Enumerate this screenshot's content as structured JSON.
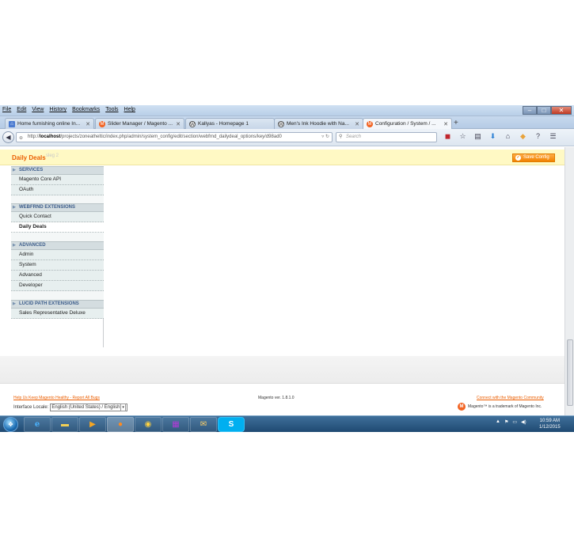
{
  "menu": [
    "File",
    "Edit",
    "View",
    "History",
    "Bookmarks",
    "Tools",
    "Help"
  ],
  "window_buttons": {
    "minimize": "–",
    "maximize": "□",
    "close": "✕"
  },
  "tabs": [
    {
      "label": "Home furnishing online In...",
      "icon": "home-icon"
    },
    {
      "label": "Slider Manager / Magento ...",
      "icon": "magento-icon"
    },
    {
      "label": "Kallyas - Homepage 1",
      "icon": "wordpress-icon"
    },
    {
      "label": "Men's Ink Hoodie with Na...",
      "icon": "wordpress-icon"
    },
    {
      "label": "Configuration / System / ...",
      "icon": "magento-icon",
      "active": true
    }
  ],
  "url": {
    "prefix": "http://",
    "host": "localhost",
    "path": "/projects/zoneatheltic/index.php/admin/system_config/edit/section/webfrnd_dailydeal_options/key/d98ad0"
  },
  "search": {
    "placeholder": "Search"
  },
  "page": {
    "title": "Daily Deals",
    "ghost_text": "sleg 2",
    "save_button": "Save Config"
  },
  "sidebar": {
    "sections": [
      {
        "header": "SERVICES",
        "items": [
          "Magento Core API",
          "OAuth"
        ]
      },
      {
        "header": "WEBFRND EXTENSIONS",
        "items": [
          "Quick Contact",
          "Daily Deals"
        ]
      },
      {
        "header": "ADVANCED",
        "items": [
          "Admin",
          "System",
          "Advanced",
          "Developer"
        ]
      },
      {
        "header": "LUCID PATH EXTENSIONS",
        "items": [
          "Sales Representative Deluxe"
        ]
      }
    ],
    "active_item": "Daily Deals"
  },
  "footer": {
    "help_link": "Help Us Keep Magento Healthy - Report All Bugs",
    "locale_label": "Interface Locale:",
    "locale_value": "English (United States) / English",
    "version": "Magento ver. 1.8.1.0",
    "community_link": "Connect with the Magento Community",
    "trademark": "Magento™ is a trademark of Magento Inc."
  },
  "taskbar": {
    "time": "10:59 AM",
    "date": "1/12/2015"
  },
  "colors": {
    "accent_orange": "#eb5e00",
    "message_bar": "#fff9c4",
    "sidebar_header": "#d4dde0",
    "sidebar_item": "#e7efef"
  }
}
